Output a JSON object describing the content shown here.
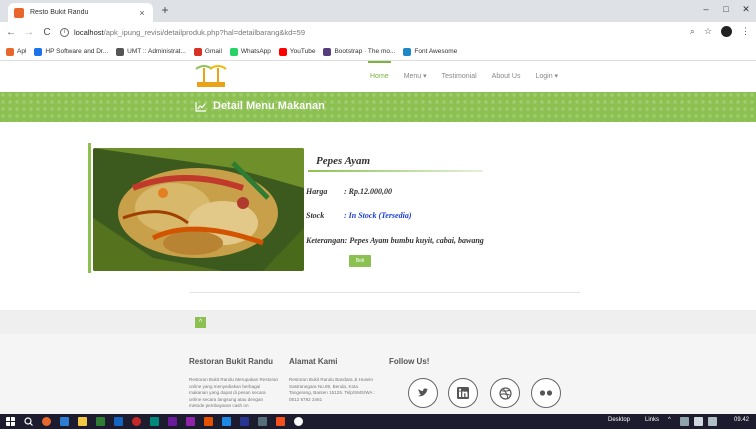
{
  "browser": {
    "tab_title": "Resto Bukit Randu",
    "tab_close": "×",
    "new_tab": "+",
    "minimize": "–",
    "restore": "□",
    "close": "✕",
    "back": "←",
    "forward": "→",
    "reload": "C",
    "url_host": "localhost",
    "url_path": "/apk_ipung_revisi/detailproduk.php?hal=detailbarang&kd=59",
    "zoom_icon": "⌕",
    "star_icon": "☆",
    "menu_dots": "⋮"
  },
  "bookmarks": [
    {
      "label": "Apl",
      "color": "#e8672c"
    },
    {
      "label": "HP Software and Dr...",
      "color": "#1a73e8"
    },
    {
      "label": "UMT :: Administrat...",
      "color": "#555555"
    },
    {
      "label": "Gmail",
      "color": "#d93025"
    },
    {
      "label": "WhatsApp",
      "color": "#25d366"
    },
    {
      "label": "YouTube",
      "color": "#ff0000"
    },
    {
      "label": "Bootstrap · The mo...",
      "color": "#563d7c"
    },
    {
      "label": "Font Awesome",
      "color": "#1c88c7"
    }
  ],
  "nav": {
    "items": [
      {
        "label": "Home",
        "active": true
      },
      {
        "label": "Menu ▾",
        "active": false
      },
      {
        "label": "Testimonial",
        "active": false
      },
      {
        "label": "About Us",
        "active": false
      },
      {
        "label": "Login ▾",
        "active": false
      }
    ],
    "logo_text": "BUKIT RANDU"
  },
  "banner": {
    "title": "Detail Menu Makanan"
  },
  "product": {
    "name": "Pepes Ayam",
    "price_label": "Harga",
    "price_value": ": Rp.12.000,00",
    "stock_label": "Stock",
    "stock_value": ": In Stock (Tersedia)",
    "desc_label": "Keterangan",
    "desc_value": ": Pepes Ayam bumbu kuyit, cabai, bawang",
    "button_label": "Beli"
  },
  "footer": {
    "to_top": "^",
    "col1_title": "Restoran Bukit Randu",
    "col1_text": "Restoran Bukit Randu Merupakan Restoran online yang menyediakan berbagai makanan yang dapat di pesan secara online secara langsung atau dengan metode pembayaran cash on",
    "col2_title": "Alamat Kami",
    "col2_text": "Restoran Bukit Randu Bandara JI.Husein Sastranegara No.89, Benda, Kota Tangerang, Banten 15125. Telp/SMS/WA : 0812 8792 2461",
    "col3_title": "Follow Us!",
    "social": [
      "twitter",
      "linkedin",
      "dribbble",
      "flickr"
    ]
  },
  "taskbar": {
    "desktop_label": "Desktop",
    "links_label": "Links",
    "time": "09.42"
  }
}
